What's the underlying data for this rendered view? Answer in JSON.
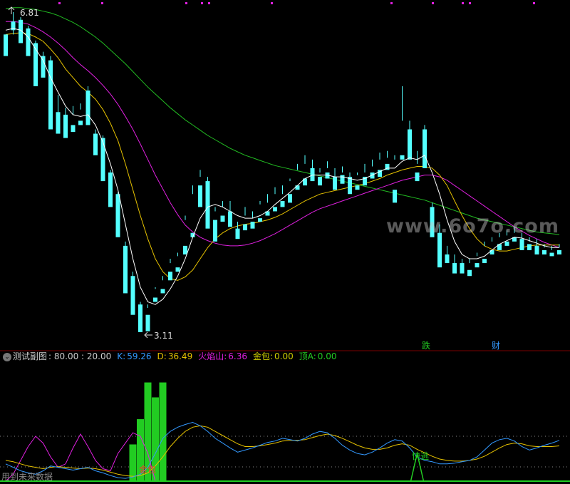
{
  "colors": {
    "up": "#ff3232",
    "down": "#54ffff",
    "ma_white": "#ffffff",
    "ma_yellow": "#e6c200",
    "ma_magenta": "#e020e0",
    "ma_green": "#22bb22",
    "k_line": "#3399ff",
    "d_line": "#e6c200",
    "fire": "#e020e0",
    "jinbao": "#cccc00",
    "top_a": "#22cc22"
  },
  "price_labels": {
    "high": "6.81",
    "low": "3.11"
  },
  "signals": {
    "die": "跌",
    "cai": "财",
    "jinbao": "金包",
    "kuaitao": "快逃"
  },
  "watermark": "www.6o7o.com",
  "indicator_header": {
    "name": "测试副图",
    "levels": ": 80.00 : 20.00",
    "k_label": "K:",
    "k_value": "59.26",
    "d_label": "D:",
    "d_value": "36.49",
    "fire_label": "火焰山:",
    "fire_value": "6.36",
    "jinbao_label": "金包:",
    "jinbao_value": "0.00",
    "topa_label": "顶A:",
    "topa_value": "0.00"
  },
  "footer_note": "用到未来数据",
  "chart_data": {
    "type": "candlestick",
    "ylim": [
      3.0,
      6.9
    ],
    "candles": [
      [
        6.55,
        6.55,
        6.4,
        6.3
      ],
      [
        6.7,
        6.81,
        6.55,
        6.6
      ],
      [
        6.72,
        6.75,
        6.55,
        6.45
      ],
      [
        6.62,
        6.65,
        6.4,
        6.3
      ],
      [
        6.45,
        6.48,
        6.02,
        5.95
      ],
      [
        6.3,
        6.35,
        6.1,
        6.05
      ],
      [
        6.25,
        6.3,
        5.55,
        5.45
      ],
      [
        5.65,
        5.85,
        5.55,
        5.4
      ],
      [
        5.62,
        5.7,
        5.42,
        5.35
      ],
      [
        5.5,
        5.72,
        5.62,
        5.42
      ],
      [
        5.55,
        5.75,
        5.68,
        5.5
      ],
      [
        5.9,
        5.95,
        5.7,
        5.5
      ],
      [
        5.4,
        5.45,
        5.22,
        5.15
      ],
      [
        5.35,
        5.38,
        4.9,
        4.85
      ],
      [
        4.95,
        4.98,
        4.62,
        4.55
      ],
      [
        4.7,
        4.72,
        4.3,
        4.2
      ],
      [
        4.1,
        4.15,
        3.7,
        3.55
      ],
      [
        3.75,
        3.8,
        3.4,
        3.3
      ],
      [
        3.42,
        3.45,
        3.15,
        3.1
      ],
      [
        3.3,
        3.42,
        3.38,
        3.11
      ],
      [
        3.5,
        3.62,
        3.6,
        3.45
      ],
      [
        3.6,
        3.75,
        3.7,
        3.55
      ],
      [
        3.8,
        3.95,
        3.9,
        3.7
      ],
      [
        3.85,
        4.02,
        3.98,
        3.8
      ],
      [
        4.1,
        4.45,
        4.4,
        4.0
      ],
      [
        4.25,
        4.8,
        4.7,
        4.2
      ],
      [
        4.8,
        4.98,
        4.9,
        4.55
      ],
      [
        4.85,
        4.9,
        4.35,
        4.3
      ],
      [
        4.4,
        4.55,
        4.5,
        4.15
      ],
      [
        4.45,
        4.62,
        4.55,
        4.38
      ],
      [
        4.5,
        4.62,
        4.4,
        4.32
      ],
      [
        4.3,
        4.38,
        4.25,
        4.18
      ],
      [
        4.35,
        4.55,
        4.45,
        4.28
      ],
      [
        4.38,
        4.5,
        4.42,
        4.3
      ],
      [
        4.42,
        4.62,
        4.58,
        4.38
      ],
      [
        4.5,
        4.7,
        4.6,
        4.45
      ],
      [
        4.55,
        4.78,
        4.7,
        4.5
      ],
      [
        4.62,
        4.8,
        4.7,
        4.55
      ],
      [
        4.7,
        4.88,
        4.85,
        4.6
      ],
      [
        4.8,
        5.05,
        4.98,
        4.75
      ],
      [
        4.88,
        5.15,
        5.05,
        4.8
      ],
      [
        5.0,
        5.1,
        4.92,
        4.85
      ],
      [
        4.9,
        5.0,
        4.95,
        4.8
      ],
      [
        4.95,
        5.08,
        5.0,
        4.88
      ],
      [
        4.9,
        5.0,
        4.8,
        4.75
      ],
      [
        4.92,
        5.02,
        4.95,
        4.82
      ],
      [
        4.9,
        4.95,
        4.75,
        4.7
      ],
      [
        4.8,
        4.95,
        4.92,
        4.75
      ],
      [
        4.9,
        5.05,
        4.95,
        4.8
      ],
      [
        4.95,
        5.1,
        5.02,
        4.88
      ],
      [
        4.98,
        5.18,
        5.1,
        4.9
      ],
      [
        5.05,
        5.2,
        5.12,
        4.98
      ],
      [
        4.75,
        5.15,
        5.1,
        4.6
      ],
      [
        5.15,
        5.95,
        5.55,
        5.1
      ],
      [
        5.45,
        5.55,
        5.2,
        5.1
      ],
      [
        4.95,
        5.2,
        5.05,
        4.85
      ],
      [
        5.45,
        5.5,
        5.05,
        5.0
      ],
      [
        4.55,
        4.6,
        4.3,
        4.2
      ],
      [
        4.25,
        4.35,
        4.05,
        3.85
      ],
      [
        4.0,
        4.1,
        3.98,
        3.9
      ],
      [
        3.9,
        4.0,
        3.85,
        3.78
      ],
      [
        3.9,
        3.95,
        3.88,
        3.78
      ],
      [
        3.82,
        3.95,
        3.9,
        3.75
      ],
      [
        3.9,
        4.02,
        3.98,
        3.85
      ],
      [
        3.95,
        4.15,
        4.1,
        3.9
      ],
      [
        4.05,
        4.2,
        4.15,
        4.0
      ],
      [
        4.12,
        4.25,
        4.2,
        4.05
      ],
      [
        4.15,
        4.28,
        4.22,
        4.1
      ],
      [
        4.2,
        4.32,
        4.25,
        4.15
      ],
      [
        4.18,
        4.25,
        4.1,
        4.05
      ],
      [
        4.12,
        4.2,
        4.15,
        4.05
      ],
      [
        4.1,
        4.18,
        4.05,
        4.0
      ],
      [
        4.05,
        4.12,
        4.08,
        4.0
      ],
      [
        4.02,
        4.1,
        4.05,
        3.98
      ],
      [
        4.05,
        4.12,
        4.08,
        4.0
      ]
    ],
    "ma_white": [
      6.6,
      6.62,
      6.6,
      6.52,
      6.38,
      6.25,
      6.05,
      5.88,
      5.72,
      5.62,
      5.6,
      5.62,
      5.5,
      5.3,
      5.05,
      4.75,
      4.35,
      3.95,
      3.62,
      3.45,
      3.42,
      3.48,
      3.6,
      3.75,
      3.95,
      4.2,
      4.42,
      4.55,
      4.58,
      4.55,
      4.5,
      4.45,
      4.42,
      4.42,
      4.45,
      4.5,
      4.58,
      4.65,
      4.72,
      4.8,
      4.88,
      4.92,
      4.92,
      4.92,
      4.9,
      4.9,
      4.88,
      4.86,
      4.88,
      4.92,
      4.96,
      5.0,
      5.0,
      5.08,
      5.12,
      5.1,
      5.15,
      4.95,
      4.7,
      4.4,
      4.15,
      4.0,
      3.95,
      3.95,
      3.98,
      4.05,
      4.12,
      4.16,
      4.2,
      4.19,
      4.16,
      4.13,
      4.1,
      4.08,
      4.08
    ],
    "ma_yellow": [
      6.55,
      6.56,
      6.57,
      6.56,
      6.52,
      6.47,
      6.38,
      6.28,
      6.15,
      6.05,
      5.95,
      5.88,
      5.8,
      5.68,
      5.52,
      5.32,
      5.05,
      4.75,
      4.45,
      4.18,
      3.95,
      3.8,
      3.72,
      3.7,
      3.74,
      3.82,
      3.95,
      4.08,
      4.18,
      4.25,
      4.3,
      4.33,
      4.35,
      4.36,
      4.38,
      4.4,
      4.43,
      4.47,
      4.52,
      4.57,
      4.62,
      4.66,
      4.7,
      4.72,
      4.74,
      4.76,
      4.78,
      4.8,
      4.82,
      4.85,
      4.88,
      4.92,
      4.95,
      4.98,
      5.0,
      5.02,
      5.02,
      5.0,
      4.92,
      4.8,
      4.62,
      4.45,
      4.3,
      4.18,
      4.1,
      4.06,
      4.04,
      4.04,
      4.06,
      4.08,
      4.1,
      4.11,
      4.11,
      4.11,
      4.11
    ],
    "ma_magenta": [
      6.7,
      6.7,
      6.69,
      6.67,
      6.63,
      6.58,
      6.52,
      6.45,
      6.37,
      6.28,
      6.2,
      6.13,
      6.05,
      5.96,
      5.86,
      5.74,
      5.6,
      5.45,
      5.28,
      5.1,
      4.92,
      4.76,
      4.6,
      4.46,
      4.34,
      4.26,
      4.2,
      4.16,
      4.13,
      4.11,
      4.1,
      4.1,
      4.11,
      4.13,
      4.16,
      4.2,
      4.24,
      4.29,
      4.34,
      4.39,
      4.44,
      4.49,
      4.53,
      4.56,
      4.59,
      4.62,
      4.65,
      4.68,
      4.71,
      4.74,
      4.77,
      4.8,
      4.83,
      4.86,
      4.88,
      4.9,
      4.92,
      4.92,
      4.9,
      4.86,
      4.8,
      4.74,
      4.68,
      4.62,
      4.56,
      4.5,
      4.44,
      4.38,
      4.32,
      4.27,
      4.22,
      4.18,
      4.14,
      4.11,
      4.08
    ],
    "ma_green": [
      6.85,
      6.86,
      6.86,
      6.85,
      6.84,
      6.82,
      6.8,
      6.77,
      6.73,
      6.69,
      6.64,
      6.58,
      6.52,
      6.45,
      6.37,
      6.29,
      6.21,
      6.12,
      6.03,
      5.94,
      5.86,
      5.78,
      5.7,
      5.63,
      5.56,
      5.5,
      5.44,
      5.38,
      5.33,
      5.28,
      5.23,
      5.19,
      5.15,
      5.12,
      5.09,
      5.06,
      5.03,
      5.01,
      4.99,
      4.97,
      4.95,
      4.93,
      4.91,
      4.89,
      4.87,
      4.85,
      4.83,
      4.81,
      4.79,
      4.77,
      4.75,
      4.73,
      4.71,
      4.69,
      4.67,
      4.65,
      4.63,
      4.6,
      4.57,
      4.54,
      4.51,
      4.48,
      4.45,
      4.42,
      4.4,
      4.38,
      4.36,
      4.34,
      4.32,
      4.3,
      4.28,
      4.26,
      4.25,
      4.24,
      4.23
    ],
    "indicator": {
      "ylim": [
        0,
        100
      ],
      "levels": [
        80,
        20
      ],
      "k": [
        25,
        20,
        15,
        12,
        10,
        15,
        22,
        20,
        18,
        16,
        18,
        20,
        15,
        12,
        8,
        5,
        4,
        6,
        10,
        20,
        40,
        62,
        72,
        78,
        82,
        85,
        80,
        72,
        62,
        55,
        48,
        42,
        45,
        48,
        52,
        56,
        58,
        62,
        60,
        58,
        62,
        68,
        72,
        70,
        62,
        52,
        45,
        40,
        38,
        42,
        48,
        55,
        60,
        58,
        48,
        35,
        30,
        28,
        25,
        25,
        26,
        28,
        30,
        35,
        45,
        55,
        60,
        62,
        58,
        50,
        45,
        48,
        52,
        55,
        59
      ],
      "d": [
        30,
        28,
        25,
        22,
        20,
        18,
        20,
        21,
        20,
        19,
        18,
        19,
        18,
        16,
        13,
        10,
        8,
        7,
        8,
        12,
        22,
        35,
        50,
        62,
        72,
        78,
        80,
        78,
        72,
        66,
        60,
        54,
        50,
        50,
        51,
        53,
        55,
        58,
        59,
        59,
        60,
        63,
        66,
        68,
        66,
        62,
        57,
        52,
        48,
        46,
        46,
        48,
        52,
        54,
        52,
        46,
        41,
        36,
        32,
        30,
        29,
        29,
        30,
        32,
        36,
        42,
        48,
        53,
        55,
        54,
        51,
        50,
        50,
        50,
        51
      ],
      "fire": [
        0,
        10,
        30,
        50,
        65,
        55,
        35,
        20,
        25,
        48,
        68,
        50,
        30,
        18,
        15,
        40,
        55,
        70,
        65,
        40,
        0,
        0,
        0,
        0,
        0,
        0,
        0,
        0,
        0,
        0,
        0,
        0,
        0,
        0,
        0,
        0,
        0,
        0,
        0,
        0,
        0,
        0,
        0,
        0,
        0,
        0,
        0,
        0,
        0,
        0,
        0,
        0,
        0,
        0,
        0,
        0,
        0,
        0,
        0,
        0,
        0,
        0,
        0,
        0,
        0,
        0,
        0,
        0,
        0,
        0,
        0,
        0,
        0,
        0,
        0
      ],
      "bars": [
        [
          17,
          32
        ],
        [
          18,
          54
        ],
        [
          19,
          86
        ],
        [
          20,
          73
        ],
        [
          21,
          86
        ]
      ],
      "spike_at": 55,
      "spike_height": 40
    }
  }
}
